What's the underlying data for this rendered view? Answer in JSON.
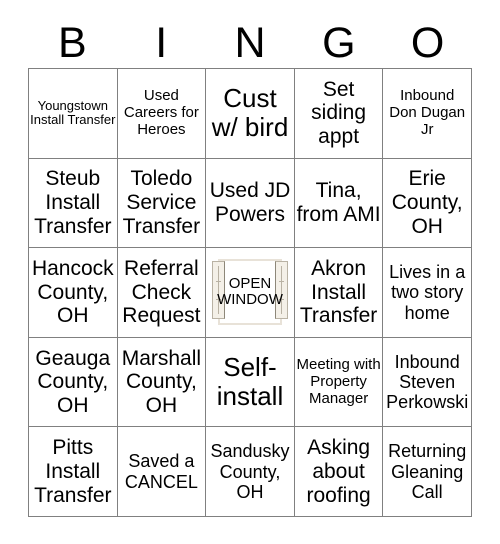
{
  "card": {
    "header_letters": [
      "B",
      "I",
      "N",
      "G",
      "O"
    ],
    "grid_line_color": "#808080",
    "background_color": "#ffffff",
    "text_color": "#000000"
  },
  "free_space": {
    "line1": "OPEN",
    "line2": "WINDOW",
    "icon": "open-window-icon",
    "frame_color": "#e8e2d8",
    "sash_color": "#f4f0e8"
  },
  "rows": [
    [
      {
        "text": "Youngstown Install Transfer",
        "size": "fs-xs"
      },
      {
        "text": "Used Careers for Heroes",
        "size": "fs-s"
      },
      {
        "text": "Cust w/ bird",
        "size": "fs-xl"
      },
      {
        "text": "Set siding appt",
        "size": "fs-l"
      },
      {
        "text": "Inbound Don Dugan Jr",
        "size": "fs-s"
      }
    ],
    [
      {
        "text": "Steub Install Transfer",
        "size": "fs-l"
      },
      {
        "text": "Toledo Service Transfer",
        "size": "fs-l"
      },
      {
        "text": "Used JD Powers",
        "size": "fs-l"
      },
      {
        "text": "Tina, from AMI",
        "size": "fs-l"
      },
      {
        "text": "Erie County, OH",
        "size": "fs-l"
      }
    ],
    [
      {
        "text": "Hancock County, OH",
        "size": "fs-l"
      },
      {
        "text": "Referral Check Request",
        "size": "fs-l"
      },
      {
        "text": "",
        "size": "free"
      },
      {
        "text": "Akron Install Transfer",
        "size": "fs-l"
      },
      {
        "text": "Lives in a two story home",
        "size": "fs-m"
      }
    ],
    [
      {
        "text": "Geauga County, OH",
        "size": "fs-l"
      },
      {
        "text": "Marshall County, OH",
        "size": "fs-l"
      },
      {
        "text": "Self-install",
        "size": "fs-xl"
      },
      {
        "text": "Meeting with Property Manager",
        "size": "fs-s"
      },
      {
        "text": "Inbound Steven Perkowski",
        "size": "fs-m"
      }
    ],
    [
      {
        "text": "Pitts Install Transfer",
        "size": "fs-l"
      },
      {
        "text": "Saved a CANCEL",
        "size": "fs-m"
      },
      {
        "text": "Sandusky County, OH",
        "size": "fs-m"
      },
      {
        "text": "Asking about roofing",
        "size": "fs-l"
      },
      {
        "text": "Returning Gleaning Call",
        "size": "fs-m"
      }
    ]
  ]
}
